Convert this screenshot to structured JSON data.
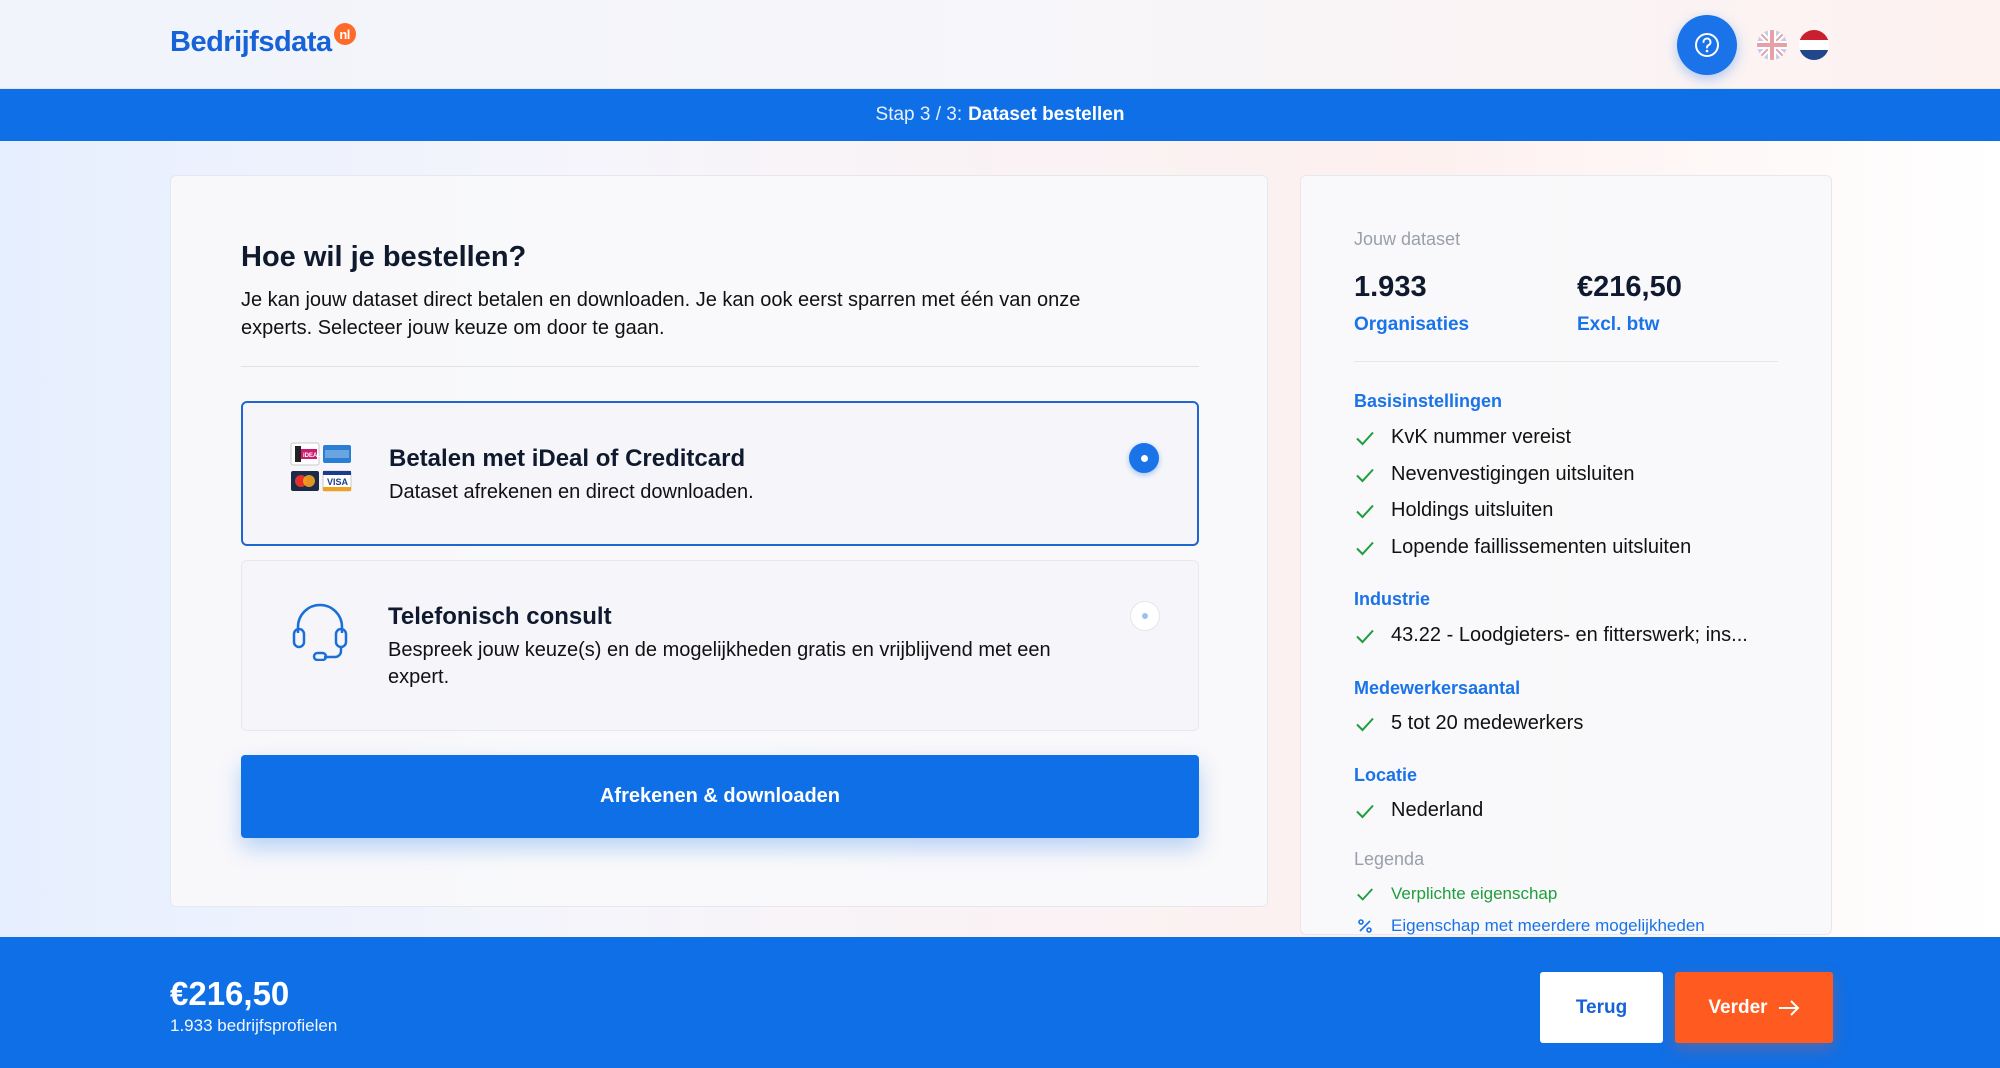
{
  "header": {
    "logo_text": "Bedrijfsdata",
    "logo_badge": "nl"
  },
  "stepbar": {
    "prefix": "Stap 3 / 3:",
    "title": "Dataset bestellen"
  },
  "main": {
    "title": "Hoe wil je bestellen?",
    "description": "Je kan jouw dataset direct betalen en downloaden. Je kan ook eerst sparren met één van onze experts. Selecteer jouw keuze om door te gaan.",
    "options": [
      {
        "title": "Betalen met iDeal of Creditcard",
        "description": "Dataset afrekenen en direct downloaden.",
        "selected": true
      },
      {
        "title": "Telefonisch consult",
        "description": "Bespreek jouw keuze(s) en de mogelijkheden gratis en vrijblijvend met een expert.",
        "selected": false
      }
    ],
    "cta_label": "Afrekenen & downloaden"
  },
  "sidebar": {
    "heading": "Jouw dataset",
    "stats": [
      {
        "value": "1.933",
        "label": "Organisaties"
      },
      {
        "value": "€216,50",
        "label": "Excl. btw"
      }
    ],
    "sections": [
      {
        "title": "Basisinstellingen",
        "items": [
          "KvK nummer vereist",
          "Nevenvestigingen uitsluiten",
          "Holdings uitsluiten",
          "Lopende faillissementen uitsluiten"
        ]
      },
      {
        "title": "Industrie",
        "items": [
          "43.22 - Loodgieters- en fitterswerk; ins..."
        ]
      },
      {
        "title": "Medewerkersaantal",
        "items": [
          "5 tot 20 medewerkers"
        ]
      },
      {
        "title": "Locatie",
        "items": [
          "Nederland"
        ]
      }
    ],
    "legend": {
      "title": "Legenda",
      "items": [
        {
          "icon": "check-icon",
          "label": "Verplichte eigenschap"
        },
        {
          "icon": "percent-icon",
          "label": "Eigenschap met meerdere mogelijkheden"
        }
      ]
    }
  },
  "footer": {
    "price": "€216,50",
    "subtitle": "1.933 bedrijfsprofielen",
    "back_label": "Terug",
    "next_label": "Verder"
  },
  "colors": {
    "primary": "#0f6fe6",
    "accent": "#ff5a1f",
    "check": "#1f9e3c"
  }
}
